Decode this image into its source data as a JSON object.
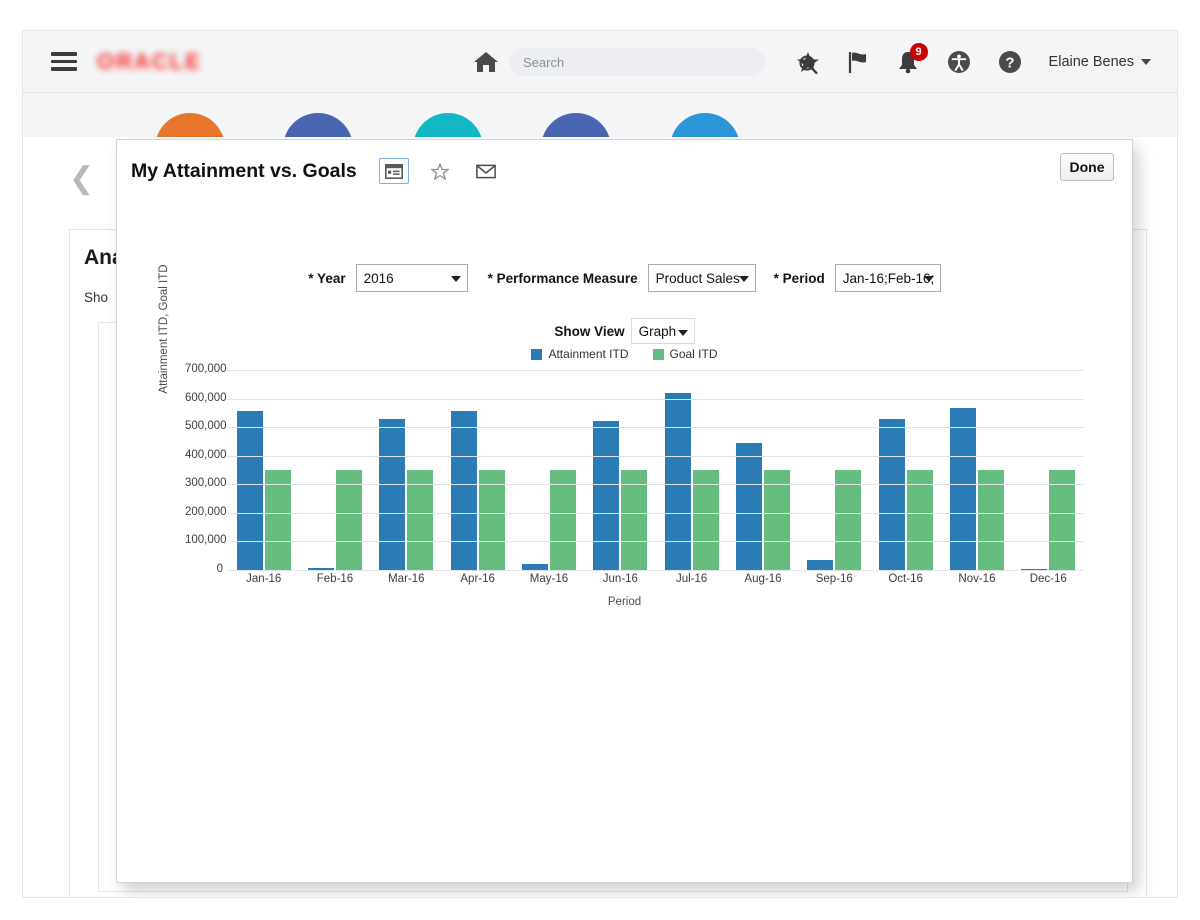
{
  "header": {
    "menu_icon": "hamburger-menu-icon",
    "brand": "ORACLE",
    "home_icon": "home-icon",
    "search": {
      "placeholder": "Search",
      "value": ""
    },
    "search_icon": "search-icon",
    "favorites_icon": "star-icon",
    "flag_icon": "flag-icon",
    "notifications_icon": "bell-icon",
    "notifications_count": "9",
    "accessibility_icon": "accessibility-icon",
    "help_icon": "help-question-icon",
    "user_name": "Elaine Benes",
    "user_caret_icon": "chevron-down-icon"
  },
  "background_page": {
    "back_icon": "chevron-left-icon",
    "title": "Ana",
    "subtitle": "Sho",
    "search_icon": "search-icon",
    "springboard_circles": [
      "#e8762d",
      "#4a66b0",
      "#12b8c4",
      "#4a66b0",
      "#2b96d8"
    ]
  },
  "modal": {
    "title": "My Attainment vs. Goals",
    "actions": [
      {
        "name": "layout-icon",
        "glyph": "▤",
        "selected": true
      },
      {
        "name": "star-icon",
        "glyph": "☆",
        "selected": false
      },
      {
        "name": "envelope-icon",
        "glyph": "✉",
        "selected": false
      }
    ],
    "done_label": "Done"
  },
  "filters": [
    {
      "name": "year",
      "label": "* Year",
      "value": "2016"
    },
    {
      "name": "measure",
      "label": "* Performance Measure",
      "value": "Product Sales"
    },
    {
      "name": "period",
      "label": "* Period",
      "value": "Jan-16;Feb-16;"
    }
  ],
  "show_view": {
    "label": "Show View",
    "value": "Graph"
  },
  "colors": {
    "attainment": "#2b7cb5",
    "goal": "#66bd80",
    "badge_red": "#cc0000",
    "brand_red": "#f80000"
  },
  "chart_data": {
    "type": "bar",
    "title": "",
    "xlabel": "Period",
    "ylabel": "Attainment ITD, Goal ITD",
    "ylim": [
      0,
      700000
    ],
    "yticks": [
      "0",
      "100,000",
      "200,000",
      "300,000",
      "400,000",
      "500,000",
      "600,000",
      "700,000"
    ],
    "ytick_values": [
      0,
      100000,
      200000,
      300000,
      400000,
      500000,
      600000,
      700000
    ],
    "grid": true,
    "legend_position": "top",
    "categories": [
      "Jan-16",
      "Feb-16",
      "Mar-16",
      "Apr-16",
      "May-16",
      "Jun-16",
      "Jul-16",
      "Aug-16",
      "Sep-16",
      "Oct-16",
      "Nov-16",
      "Dec-16"
    ],
    "series": [
      {
        "name": "Attainment ITD",
        "color": "#2b7cb5",
        "values": [
          555000,
          8000,
          530000,
          555000,
          20000,
          520000,
          620000,
          445000,
          35000,
          530000,
          568000,
          5000
        ]
      },
      {
        "name": "Goal ITD",
        "color": "#66bd80",
        "values": [
          350000,
          350000,
          350000,
          350000,
          350000,
          350000,
          350000,
          350000,
          350000,
          350000,
          350000,
          350000
        ]
      }
    ]
  }
}
